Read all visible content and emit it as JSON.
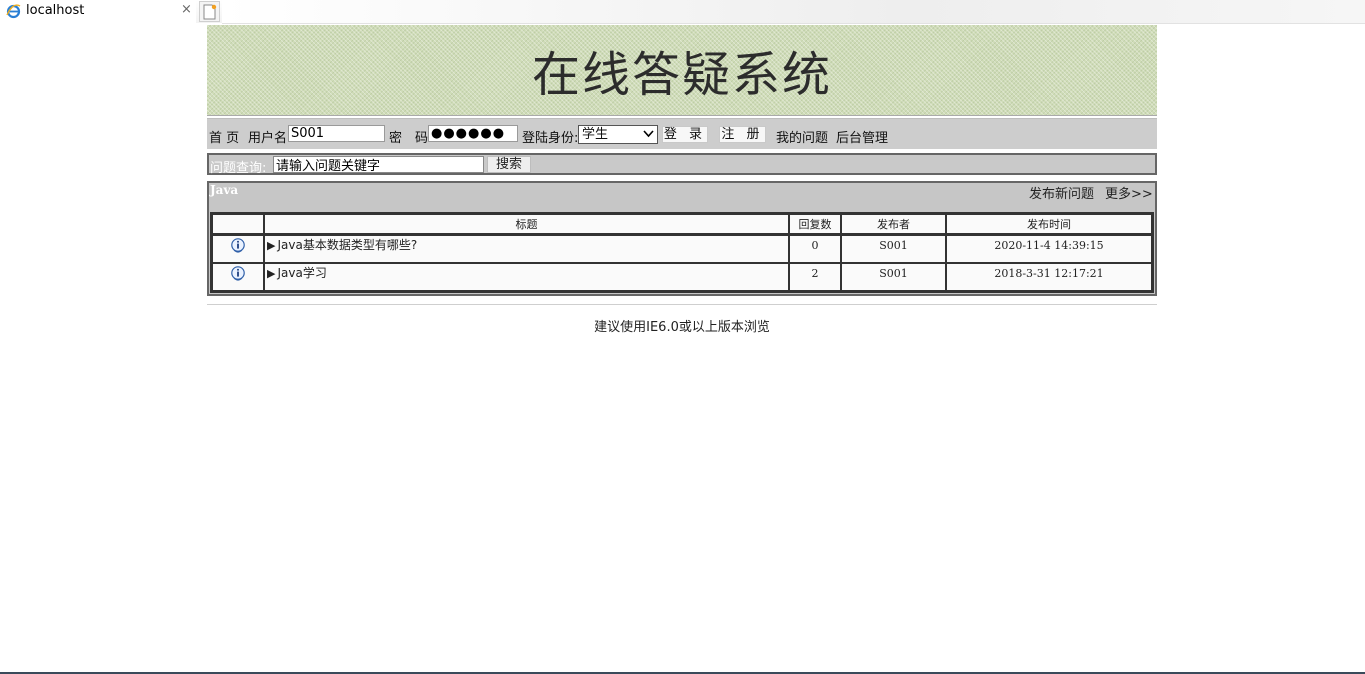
{
  "browser": {
    "tab_title": "localhost",
    "close_glyph": "×"
  },
  "header": {
    "title": "在线答疑系统"
  },
  "login": {
    "home_link": "首 页",
    "username_label": "用户名:",
    "username_value": "S001",
    "password_label": "密　码:",
    "password_value": "●●●●●●",
    "role_label": "登陆身份:",
    "role_value": "学生",
    "login_button": "登 录",
    "register_button": "注 册",
    "my_questions_link": "我的问题",
    "admin_link": "后台管理"
  },
  "search": {
    "label": "问题查询:",
    "placeholder": "请输入问题关键字",
    "button": "搜索"
  },
  "category": {
    "name": "Java",
    "new_question_link": "发布新问题",
    "more_link": "更多>>"
  },
  "table": {
    "headers": [
      "",
      "标题",
      "回复数",
      "发布者",
      "发布时间"
    ],
    "rows": [
      {
        "title": "Java基本数据类型有哪些?",
        "replies": "0",
        "author": "S001",
        "time": "2020-11-4 14:39:15"
      },
      {
        "title": "Java学习",
        "replies": "2",
        "author": "S001",
        "time": "2018-3-31 12:17:21"
      }
    ]
  },
  "footer": {
    "text": "建议使用IE6.0或以上版本浏览"
  },
  "icons": {
    "tab_icon": "ie-browser-icon",
    "row_icon": "info-icon",
    "new_tab": "new-tab-icon"
  }
}
